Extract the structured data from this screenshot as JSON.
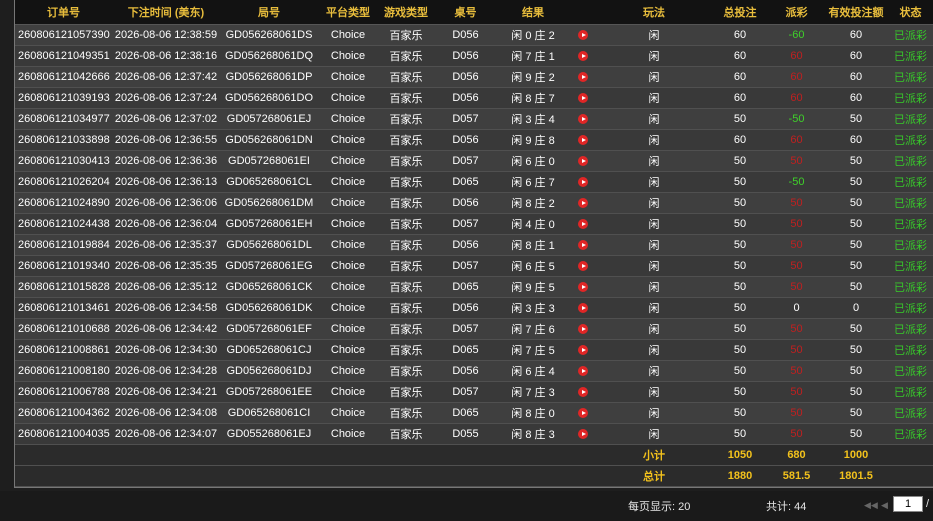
{
  "columns": [
    "订单号",
    "下注时间 (美东)",
    "局号",
    "平台类型",
    "游戏类型",
    "桌号",
    "结果",
    "",
    "玩法",
    "总投注",
    "派彩",
    "有效投注额",
    "状态"
  ],
  "rows": [
    {
      "order": "260806121057390",
      "time": "2026-08-06 12:38:59",
      "round": "GD056268061DS",
      "platform": "Choice",
      "game": "百家乐",
      "table": "D056",
      "result": "闲 0 庄 2",
      "bet_type": "闲",
      "total": "60",
      "payout": "-60",
      "payout_kind": "neg",
      "valid": "60",
      "status": "已派彩"
    },
    {
      "order": "260806121049351",
      "time": "2026-08-06 12:38:16",
      "round": "GD056268061DQ",
      "platform": "Choice",
      "game": "百家乐",
      "table": "D056",
      "result": "闲 7 庄 1",
      "bet_type": "闲",
      "total": "60",
      "payout": "60",
      "payout_kind": "pos",
      "valid": "60",
      "status": "已派彩"
    },
    {
      "order": "260806121042666",
      "time": "2026-08-06 12:37:42",
      "round": "GD056268061DP",
      "platform": "Choice",
      "game": "百家乐",
      "table": "D056",
      "result": "闲 9 庄 2",
      "bet_type": "闲",
      "total": "60",
      "payout": "60",
      "payout_kind": "pos",
      "valid": "60",
      "status": "已派彩"
    },
    {
      "order": "260806121039193",
      "time": "2026-08-06 12:37:24",
      "round": "GD056268061DO",
      "platform": "Choice",
      "game": "百家乐",
      "table": "D056",
      "result": "闲 8 庄 7",
      "bet_type": "闲",
      "total": "60",
      "payout": "60",
      "payout_kind": "pos",
      "valid": "60",
      "status": "已派彩"
    },
    {
      "order": "260806121034977",
      "time": "2026-08-06 12:37:02",
      "round": "GD057268061EJ",
      "platform": "Choice",
      "game": "百家乐",
      "table": "D057",
      "result": "闲 3 庄 4",
      "bet_type": "闲",
      "total": "50",
      "payout": "-50",
      "payout_kind": "neg",
      "valid": "50",
      "status": "已派彩"
    },
    {
      "order": "260806121033898",
      "time": "2026-08-06 12:36:55",
      "round": "GD056268061DN",
      "platform": "Choice",
      "game": "百家乐",
      "table": "D056",
      "result": "闲 9 庄 8",
      "bet_type": "闲",
      "total": "60",
      "payout": "60",
      "payout_kind": "pos",
      "valid": "60",
      "status": "已派彩"
    },
    {
      "order": "260806121030413",
      "time": "2026-08-06 12:36:36",
      "round": "GD057268061EI",
      "platform": "Choice",
      "game": "百家乐",
      "table": "D057",
      "result": "闲 6 庄 0",
      "bet_type": "闲",
      "total": "50",
      "payout": "50",
      "payout_kind": "pos",
      "valid": "50",
      "status": "已派彩"
    },
    {
      "order": "260806121026204",
      "time": "2026-08-06 12:36:13",
      "round": "GD065268061CL",
      "platform": "Choice",
      "game": "百家乐",
      "table": "D065",
      "result": "闲 6 庄 7",
      "bet_type": "闲",
      "total": "50",
      "payout": "-50",
      "payout_kind": "neg",
      "valid": "50",
      "status": "已派彩"
    },
    {
      "order": "260806121024890",
      "time": "2026-08-06 12:36:06",
      "round": "GD056268061DM",
      "platform": "Choice",
      "game": "百家乐",
      "table": "D056",
      "result": "闲 8 庄 2",
      "bet_type": "闲",
      "total": "50",
      "payout": "50",
      "payout_kind": "pos",
      "valid": "50",
      "status": "已派彩"
    },
    {
      "order": "260806121024438",
      "time": "2026-08-06 12:36:04",
      "round": "GD057268061EH",
      "platform": "Choice",
      "game": "百家乐",
      "table": "D057",
      "result": "闲 4 庄 0",
      "bet_type": "闲",
      "total": "50",
      "payout": "50",
      "payout_kind": "pos",
      "valid": "50",
      "status": "已派彩"
    },
    {
      "order": "260806121019884",
      "time": "2026-08-06 12:35:37",
      "round": "GD056268061DL",
      "platform": "Choice",
      "game": "百家乐",
      "table": "D056",
      "result": "闲 8 庄 1",
      "bet_type": "闲",
      "total": "50",
      "payout": "50",
      "payout_kind": "pos",
      "valid": "50",
      "status": "已派彩"
    },
    {
      "order": "260806121019340",
      "time": "2026-08-06 12:35:35",
      "round": "GD057268061EG",
      "platform": "Choice",
      "game": "百家乐",
      "table": "D057",
      "result": "闲 6 庄 5",
      "bet_type": "闲",
      "total": "50",
      "payout": "50",
      "payout_kind": "pos",
      "valid": "50",
      "status": "已派彩"
    },
    {
      "order": "260806121015828",
      "time": "2026-08-06 12:35:12",
      "round": "GD065268061CK",
      "platform": "Choice",
      "game": "百家乐",
      "table": "D065",
      "result": "闲 9 庄 5",
      "bet_type": "闲",
      "total": "50",
      "payout": "50",
      "payout_kind": "pos",
      "valid": "50",
      "status": "已派彩"
    },
    {
      "order": "260806121013461",
      "time": "2026-08-06 12:34:58",
      "round": "GD056268061DK",
      "platform": "Choice",
      "game": "百家乐",
      "table": "D056",
      "result": "闲 3 庄 3",
      "bet_type": "闲",
      "total": "50",
      "payout": "0",
      "payout_kind": "zero",
      "valid": "0",
      "status": "已派彩"
    },
    {
      "order": "260806121010688",
      "time": "2026-08-06 12:34:42",
      "round": "GD057268061EF",
      "platform": "Choice",
      "game": "百家乐",
      "table": "D057",
      "result": "闲 7 庄 6",
      "bet_type": "闲",
      "total": "50",
      "payout": "50",
      "payout_kind": "pos",
      "valid": "50",
      "status": "已派彩"
    },
    {
      "order": "260806121008861",
      "time": "2026-08-06 12:34:30",
      "round": "GD065268061CJ",
      "platform": "Choice",
      "game": "百家乐",
      "table": "D065",
      "result": "闲 7 庄 5",
      "bet_type": "闲",
      "total": "50",
      "payout": "50",
      "payout_kind": "pos",
      "valid": "50",
      "status": "已派彩"
    },
    {
      "order": "260806121008180",
      "time": "2026-08-06 12:34:28",
      "round": "GD056268061DJ",
      "platform": "Choice",
      "game": "百家乐",
      "table": "D056",
      "result": "闲 6 庄 4",
      "bet_type": "闲",
      "total": "50",
      "payout": "50",
      "payout_kind": "pos",
      "valid": "50",
      "status": "已派彩"
    },
    {
      "order": "260806121006788",
      "time": "2026-08-06 12:34:21",
      "round": "GD057268061EE",
      "platform": "Choice",
      "game": "百家乐",
      "table": "D057",
      "result": "闲 7 庄 3",
      "bet_type": "闲",
      "total": "50",
      "payout": "50",
      "payout_kind": "pos",
      "valid": "50",
      "status": "已派彩"
    },
    {
      "order": "260806121004362",
      "time": "2026-08-06 12:34:08",
      "round": "GD065268061CI",
      "platform": "Choice",
      "game": "百家乐",
      "table": "D065",
      "result": "闲 8 庄 0",
      "bet_type": "闲",
      "total": "50",
      "payout": "50",
      "payout_kind": "pos",
      "valid": "50",
      "status": "已派彩"
    },
    {
      "order": "260806121004035",
      "time": "2026-08-06 12:34:07",
      "round": "GD055268061EJ",
      "platform": "Choice",
      "game": "百家乐",
      "table": "D055",
      "result": "闲 8 庄 3",
      "bet_type": "闲",
      "total": "50",
      "payout": "50",
      "payout_kind": "pos",
      "valid": "50",
      "status": "已派彩"
    }
  ],
  "subtotal": {
    "label": "小计",
    "total": "1050",
    "payout": "680",
    "valid": "1000"
  },
  "grand_total": {
    "label": "总计",
    "total": "1880",
    "payout": "581.5",
    "valid": "1801.5"
  },
  "pager": {
    "per_page": "每页显示: 20",
    "count": "共计: 44",
    "page": "1",
    "sep": "/"
  },
  "icons": {
    "row_action": "play-icon",
    "first": "first-page-icon",
    "prev": "prev-page-icon"
  },
  "colors": {
    "header_text": "#e8bd3c",
    "payout_positive": "#c02020",
    "payout_negative": "#3fd12a",
    "status": "#37c82a",
    "play_icon": "#e02626"
  }
}
